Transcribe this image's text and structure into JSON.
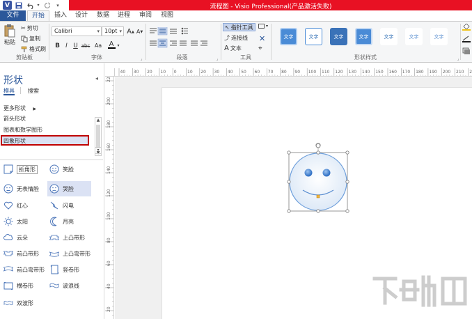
{
  "window": {
    "title": "流程图 - Visio Professional(产品激活失败)",
    "app_icon": "V"
  },
  "quick_access": [
    "save-icon",
    "undo-icon",
    "redo-icon",
    "customize-icon"
  ],
  "tabs": [
    {
      "label": "文件",
      "active": false
    },
    {
      "label": "开始",
      "active": true
    },
    {
      "label": "插入",
      "active": false
    },
    {
      "label": "设计",
      "active": false
    },
    {
      "label": "数据",
      "active": false
    },
    {
      "label": "进程",
      "active": false
    },
    {
      "label": "审阅",
      "active": false
    },
    {
      "label": "视图",
      "active": false
    }
  ],
  "ribbon": {
    "clipboard": {
      "paste": "粘贴",
      "cut": "剪切",
      "copy": "复制",
      "format_painter": "格式刷",
      "group": "剪贴板"
    },
    "font": {
      "name": "Calibri",
      "size": "10pt",
      "bold": "B",
      "italic": "I",
      "underline": "U",
      "strike": "abc",
      "case": "Aa",
      "grow": "A",
      "shrink": "A",
      "color": "A",
      "group": "字体"
    },
    "paragraph": {
      "group": "段落"
    },
    "tools": {
      "pointer": "指针工具",
      "connector": "连接线",
      "text": "文本",
      "group": "工具"
    },
    "styles": {
      "items": [
        "文字",
        "文字",
        "文字",
        "文字",
        "文字",
        "文字",
        "文字"
      ],
      "group": "形状样式"
    }
  },
  "pane": {
    "title": "形状",
    "tab_stencils": "模具",
    "tab_search": "搜索",
    "more_shapes": "更多形状",
    "stencils": [
      "箭头形状",
      "图表和数学图形",
      "四象形状"
    ],
    "selected_stencil": "四象形状",
    "shapes": [
      {
        "label": "折角形",
        "icon": "folded-corner-icon"
      },
      {
        "label": "笑脸",
        "icon": "smiley-icon"
      },
      {
        "label": "无表情脸",
        "icon": "neutral-face-icon"
      },
      {
        "label": "哭脸",
        "icon": "sad-face-icon"
      },
      {
        "label": "红心",
        "icon": "heart-icon"
      },
      {
        "label": "闪电",
        "icon": "lightning-icon"
      },
      {
        "label": "太阳",
        "icon": "sun-icon"
      },
      {
        "label": "月亮",
        "icon": "moon-icon"
      },
      {
        "label": "云朵",
        "icon": "cloud-icon"
      },
      {
        "label": "上凸带形",
        "icon": "up-ribbon-icon"
      },
      {
        "label": "前凸带形",
        "icon": "down-ribbon-icon"
      },
      {
        "label": "上凸弯带形",
        "icon": "curved-up-ribbon-icon"
      },
      {
        "label": "前凸弯带形",
        "icon": "curved-down-ribbon-icon"
      },
      {
        "label": "竖卷形",
        "icon": "vertical-scroll-icon"
      },
      {
        "label": "横卷形",
        "icon": "horizontal-scroll-icon"
      },
      {
        "label": "波浪线",
        "icon": "wave-icon"
      },
      {
        "label": "双波形",
        "icon": "double-wave-icon"
      }
    ]
  },
  "ruler": {
    "h_ticks": [
      "40",
      "30",
      "20",
      "10",
      "0",
      "10",
      "20",
      "30",
      "40",
      "50",
      "60",
      "70",
      "80",
      "90",
      "100",
      "110",
      "120",
      "130",
      "140",
      "150",
      "160",
      "170",
      "180",
      "190",
      "200",
      "210",
      "220"
    ],
    "v_ticks": [
      "220",
      "200",
      "180",
      "160",
      "140",
      "120",
      "100",
      "80",
      "60",
      "40",
      "20"
    ]
  },
  "colors": {
    "accent": "#2b579a",
    "titlebar_red": "#e81123",
    "highlight": "#dbe2f4",
    "selection_red": "#c00000"
  }
}
